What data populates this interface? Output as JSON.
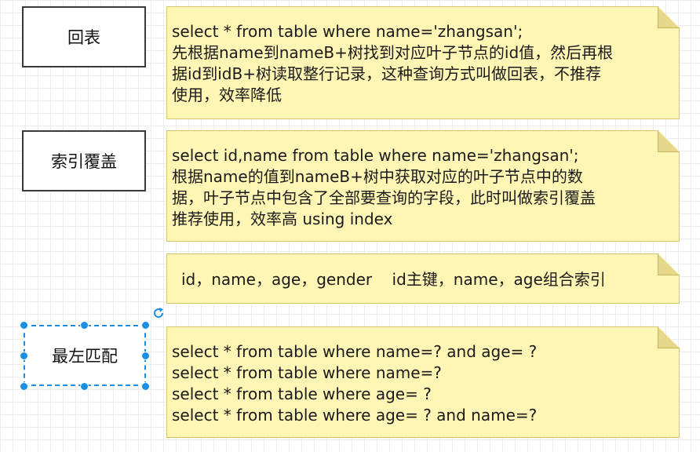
{
  "labels": {
    "back_to_table": "回表",
    "covering_index": "索引覆盖",
    "leftmost_prefix": "最左匹配"
  },
  "notes": {
    "note1": [
      "select * from table where name='zhangsan';",
      "先根据name到nameB+树找到对应叶子节点的id值，然后再根",
      "据id到idB+树读取整行记录，这种查询方式叫做回表，不推荐",
      "使用，效率降低"
    ],
    "note2": [
      "select id,name from table where name='zhangsan';",
      "根据name的值到nameB+树中获取对应的叶子节点中的数",
      "据，叶子节点中包含了全部要查询的字段，此时叫做索引覆盖",
      "推荐使用，效率高  using index"
    ],
    "note3": [
      "id，name，age，gender    id主键，name，age组合索引"
    ],
    "note4": [
      "select * from table where name=? and age= ?",
      "select * from table where name=?",
      "select * from table where age= ?",
      "select * from table where age= ? and name=?"
    ]
  },
  "colors": {
    "note_fill": "#fff6b5",
    "selection": "#1a8fe3"
  },
  "icons": {
    "rotate": "rotate-icon"
  }
}
